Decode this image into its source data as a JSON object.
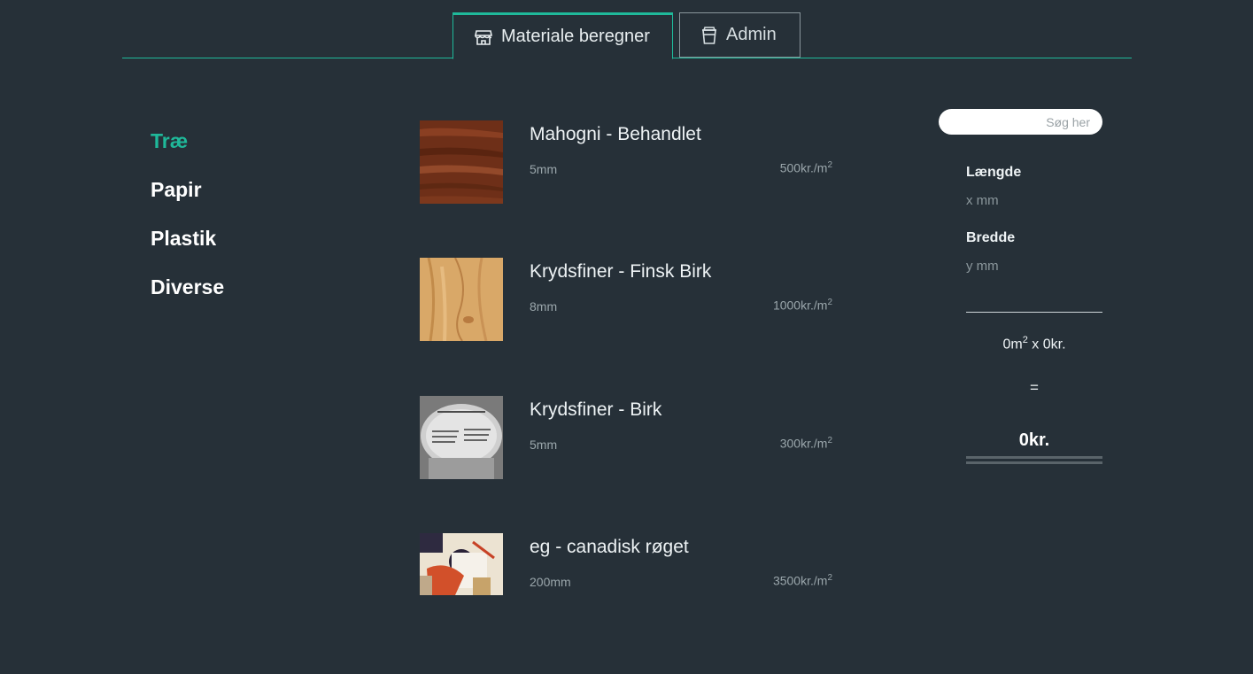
{
  "tabs": [
    {
      "label": "Materiale beregner",
      "icon": "store-icon",
      "active": true
    },
    {
      "label": "Admin",
      "icon": "cup-icon",
      "active": false
    }
  ],
  "sidebar": {
    "items": [
      {
        "label": "Træ",
        "active": true
      },
      {
        "label": "Papir",
        "active": false
      },
      {
        "label": "Plastik",
        "active": false
      },
      {
        "label": "Diverse",
        "active": false
      }
    ]
  },
  "products": [
    {
      "name": "Mahogni - Behandlet",
      "thickness": "5mm",
      "price": "500kr./m",
      "price_sup": "2"
    },
    {
      "name": "Krydsfiner - Finsk Birk",
      "thickness": "8mm",
      "price": "1000kr./m",
      "price_sup": "2"
    },
    {
      "name": "Krydsfiner - Birk",
      "thickness": "5mm",
      "price": "300kr./m",
      "price_sup": "2"
    },
    {
      "name": "eg - canadisk røget",
      "thickness": "200mm",
      "price": "3500kr./m",
      "price_sup": "2"
    }
  ],
  "calculator": {
    "search_placeholder": "Søg her",
    "length_label": "Længde",
    "length_placeholder": "x mm",
    "width_label": "Bredde",
    "width_placeholder": "y mm",
    "area": "0m",
    "area_sup": "2",
    "rate": " x 0kr.",
    "equals": "=",
    "total": "0kr."
  },
  "colors": {
    "background": "#263038",
    "accent": "#1fb99a",
    "muted_text": "#9aa6ab"
  }
}
